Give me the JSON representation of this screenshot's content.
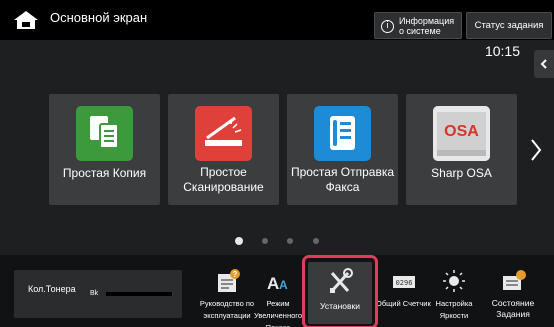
{
  "header": {
    "title": "Основной экран",
    "home_icon": "home-icon",
    "system_info_label": "Информация о системе",
    "system_info_icon": "info-icon",
    "job_status_label": "Статус задания"
  },
  "clock": "10:15",
  "tiles": [
    {
      "label": "Простая Копия",
      "icon": "copy-icon",
      "color": "#3c9a3c"
    },
    {
      "label": "Простое Сканирование",
      "icon": "scanner-icon",
      "color": "#e0403a"
    },
    {
      "label": "Простая Отправка Факса",
      "icon": "fax-icon",
      "color": "#1e8bd6"
    },
    {
      "label": "Sharp OSA",
      "icon": "sharp-osa-icon",
      "color": "#e8e8e8"
    }
  ],
  "pager": {
    "pages": 4,
    "active": 1
  },
  "toner": {
    "label": "Кол.Тонера",
    "channel": "Bk",
    "level": 1.0
  },
  "bottom_items": [
    {
      "label": "Руководство по эксплуатации",
      "icon": "manual-icon"
    },
    {
      "label": "Режим Увеличенного Показа",
      "icon": "text-size-icon"
    },
    {
      "label": "Установки",
      "icon": "settings-tools-icon"
    },
    {
      "label": "Общий Счетчик",
      "icon": "counter-icon"
    },
    {
      "label": "Настройка Яркости",
      "icon": "brightness-icon"
    },
    {
      "label": "Состояние Задания",
      "icon": "job-status-icon"
    }
  ],
  "colors": {
    "highlight": "#e23b62",
    "background": "#1e1f21",
    "tile": "#3c3d3f"
  }
}
